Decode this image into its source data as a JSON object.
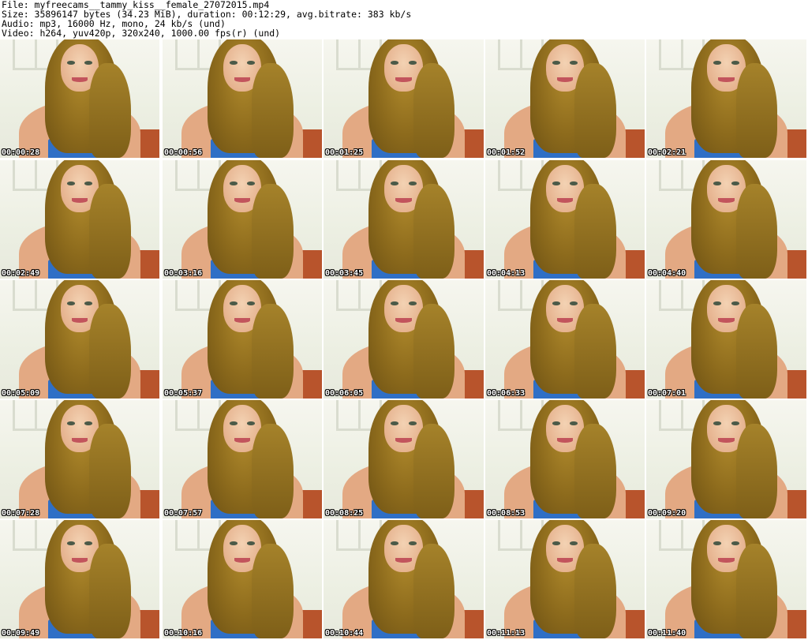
{
  "header": {
    "file_line": "File: myfreecams__tammy_kiss__female_27072015.mp4",
    "size_line": "Size: 35896147 bytes (34.23 MiB), duration: 00:12:29, avg.bitrate: 383 kb/s",
    "audio_line": "Audio: mp3, 16000 Hz, mono, 24 kb/s (und)",
    "video_line": "Video: h264, yuv420p, 320x240, 1000.00 fps(r) (und)"
  },
  "thumbnails": [
    {
      "timestamp": "00:00:28"
    },
    {
      "timestamp": "00:00:56"
    },
    {
      "timestamp": "00:01:25"
    },
    {
      "timestamp": "00:01:52"
    },
    {
      "timestamp": "00:02:21"
    },
    {
      "timestamp": "00:02:49"
    },
    {
      "timestamp": "00:03:16"
    },
    {
      "timestamp": "00:03:45"
    },
    {
      "timestamp": "00:04:13"
    },
    {
      "timestamp": "00:04:40"
    },
    {
      "timestamp": "00:05:09"
    },
    {
      "timestamp": "00:05:37"
    },
    {
      "timestamp": "00:06:05"
    },
    {
      "timestamp": "00:06:33"
    },
    {
      "timestamp": "00:07:01"
    },
    {
      "timestamp": "00:07:28"
    },
    {
      "timestamp": "00:07:57"
    },
    {
      "timestamp": "00:08:25"
    },
    {
      "timestamp": "00:08:53"
    },
    {
      "timestamp": "00:09:20"
    },
    {
      "timestamp": "00:09:49"
    },
    {
      "timestamp": "00:10:16"
    },
    {
      "timestamp": "00:10:44"
    },
    {
      "timestamp": "00:11:13"
    },
    {
      "timestamp": "00:11:40"
    }
  ]
}
